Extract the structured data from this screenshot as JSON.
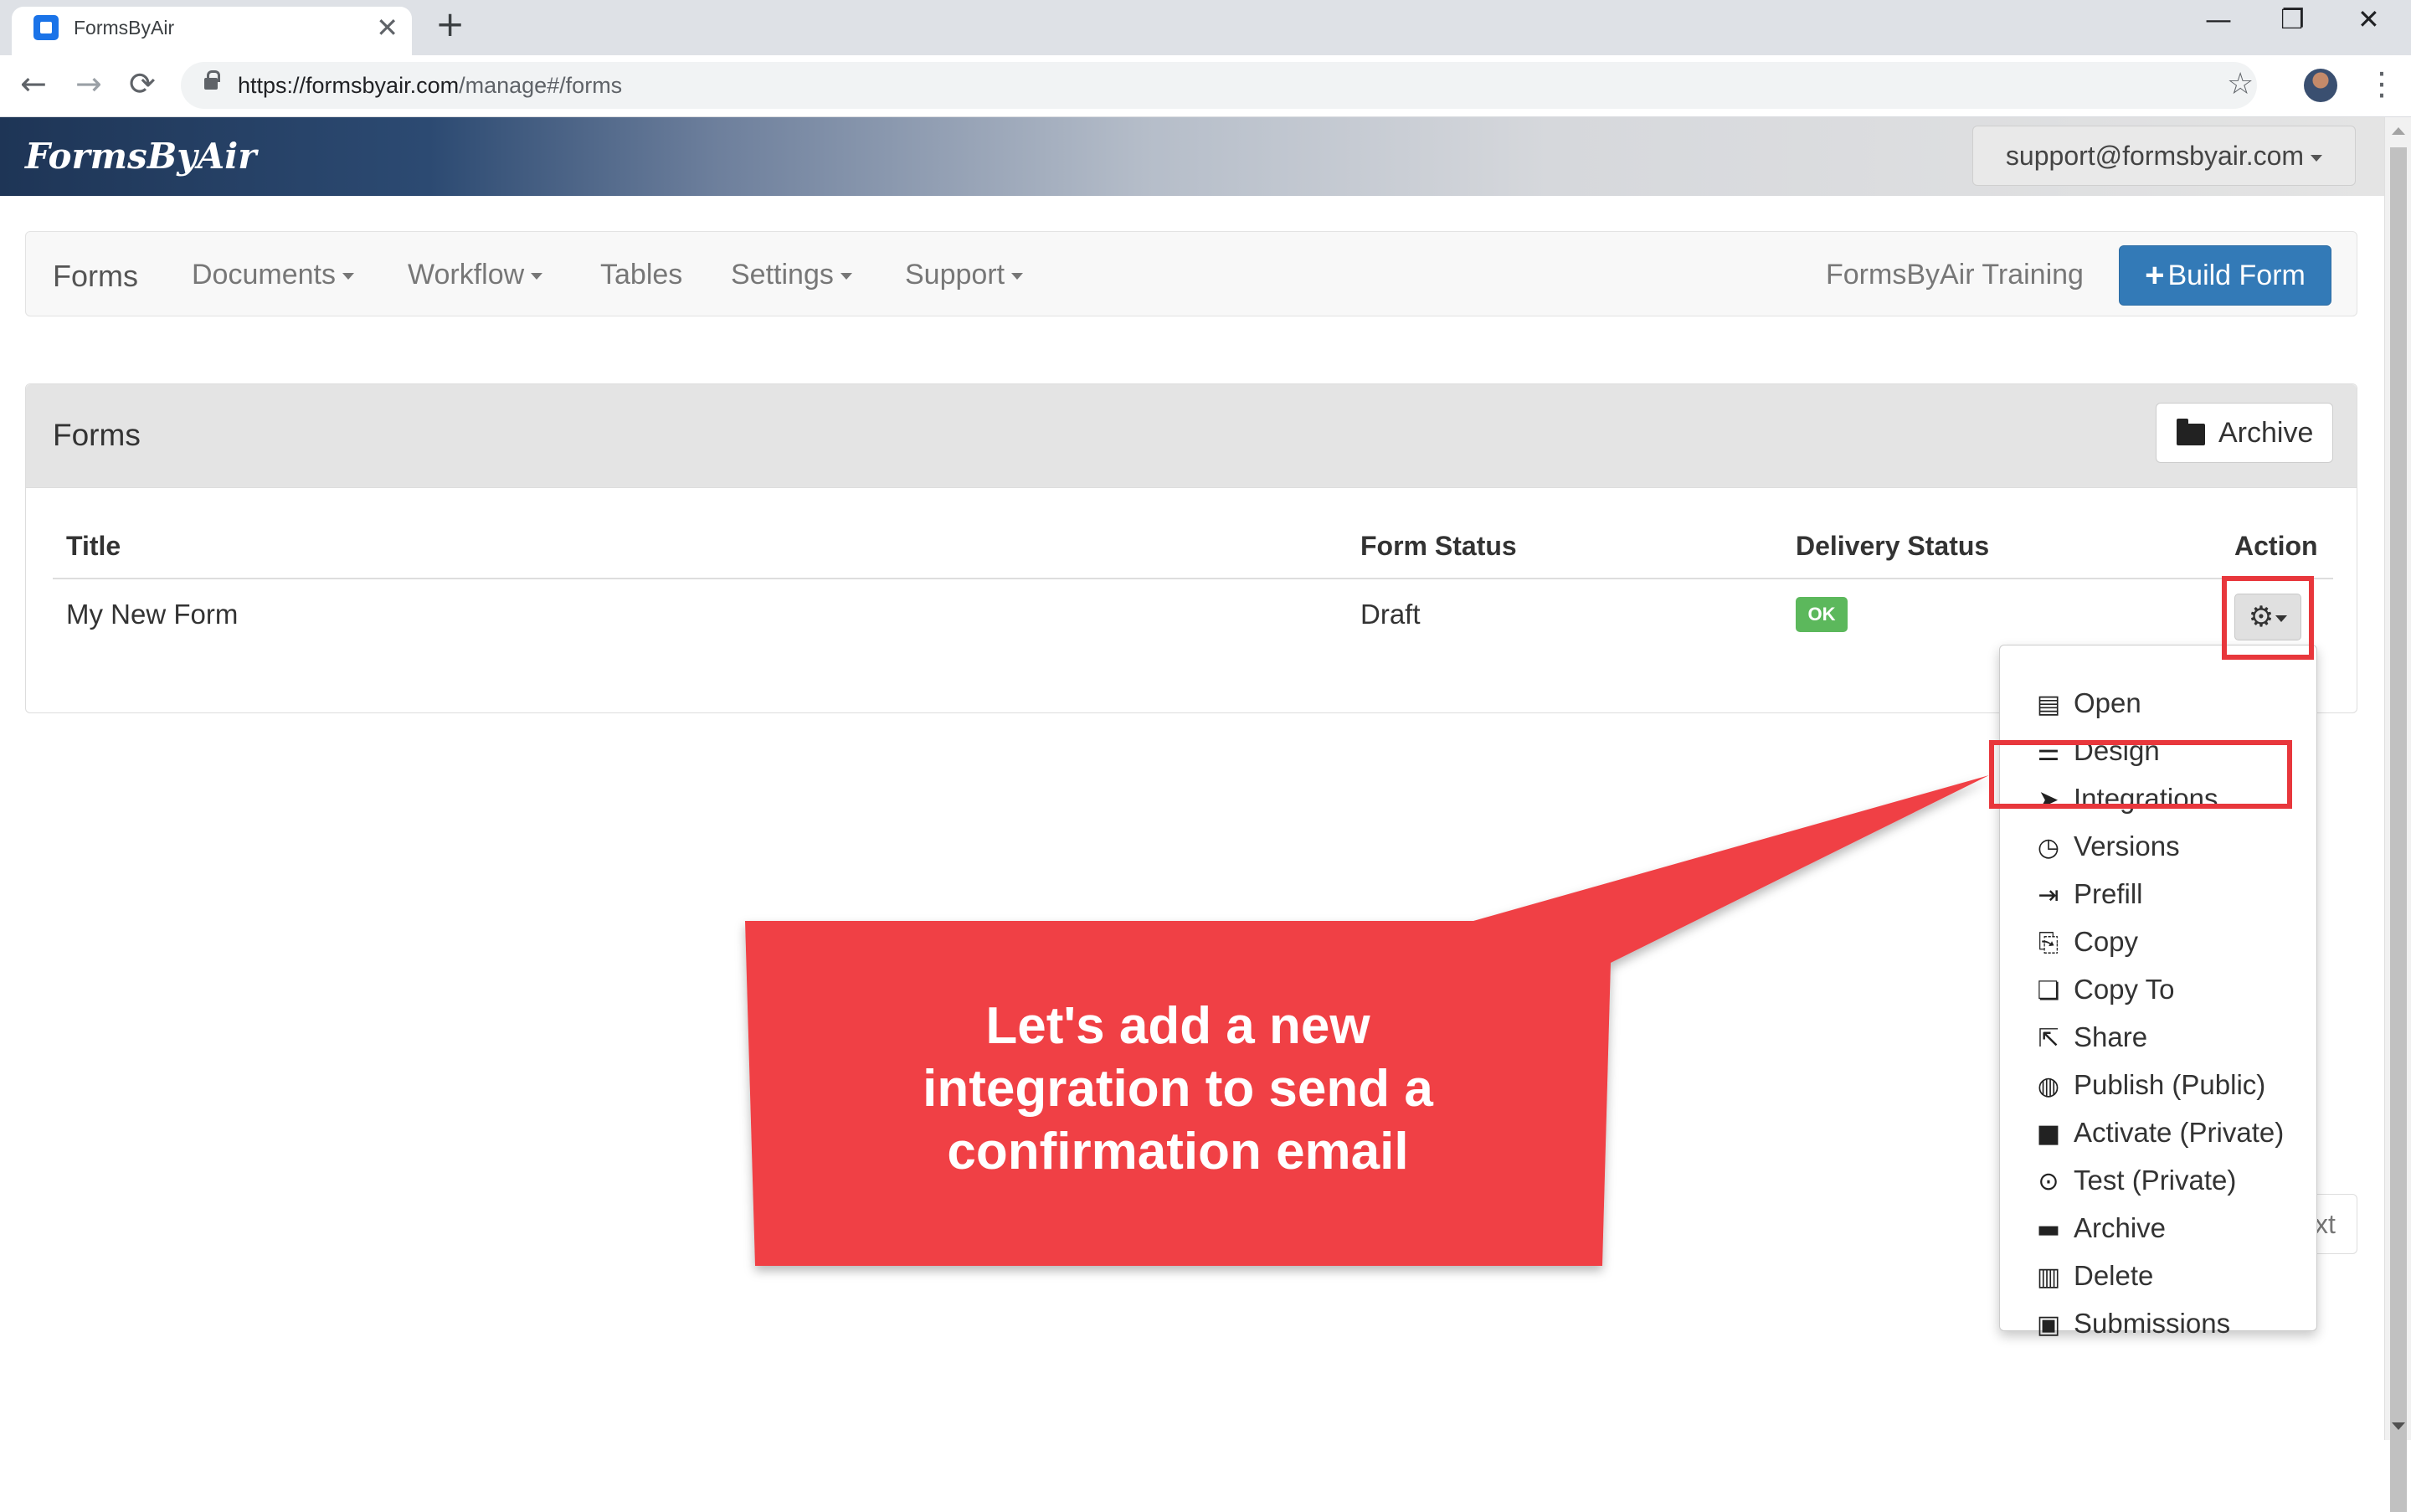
{
  "browser": {
    "tab_title": "FormsByAir",
    "new_tab": "+",
    "tab_close": "✕",
    "url_host": "https://formsbyair.com",
    "url_path": "/manage#/forms",
    "back": "←",
    "forward": "→",
    "reload": "⟳",
    "minimize": "—",
    "restore": "❐",
    "close": "✕",
    "star": "☆",
    "menu": "⋮"
  },
  "header": {
    "logo": "FormsByAir",
    "user": "support@formsbyair.com"
  },
  "navbar": {
    "items": [
      "Forms",
      "Documents",
      "Workflow",
      "Tables",
      "Settings",
      "Support"
    ],
    "training": "FormsByAir Training",
    "build_form": "Build Form",
    "build_form_icon": "plus-icon"
  },
  "panel": {
    "title": "Forms",
    "archive_button": "Archive",
    "columns": [
      "Title",
      "Form Status",
      "Delivery Status",
      "Action"
    ],
    "rows": [
      {
        "title": "My New Form",
        "form_status": "Draft",
        "delivery_status": "OK"
      }
    ]
  },
  "action_menu": {
    "items": [
      {
        "label": "Open",
        "icon": "list-icon"
      },
      {
        "label": "Design",
        "icon": "align-left-icon"
      },
      {
        "label": "Integrations",
        "icon": "send-icon"
      },
      {
        "label": "Versions",
        "icon": "clock-icon"
      },
      {
        "label": "Prefill",
        "icon": "log-in-icon"
      },
      {
        "label": "Copy",
        "icon": "copy-icon"
      },
      {
        "label": "Copy To",
        "icon": "paste-icon"
      },
      {
        "label": "Share",
        "icon": "share-icon"
      },
      {
        "label": "Publish (Public)",
        "icon": "globe-icon"
      },
      {
        "label": "Activate (Private)",
        "icon": "lock-icon"
      },
      {
        "label": "Test (Private)",
        "icon": "play-circle-icon"
      },
      {
        "label": "Archive",
        "icon": "folder-icon"
      },
      {
        "label": "Delete",
        "icon": "trash-icon"
      },
      {
        "label": "Submissions",
        "icon": "inbox-icon"
      }
    ]
  },
  "pagination": {
    "next_partial": "xt"
  },
  "callout": {
    "lines": [
      "Let's add a new",
      "integration to send a",
      "confirmation email"
    ],
    "color": "#f04045"
  },
  "colors": {
    "primary": "#337ab7",
    "success": "#5cb85c",
    "highlight": "#e8373c"
  }
}
